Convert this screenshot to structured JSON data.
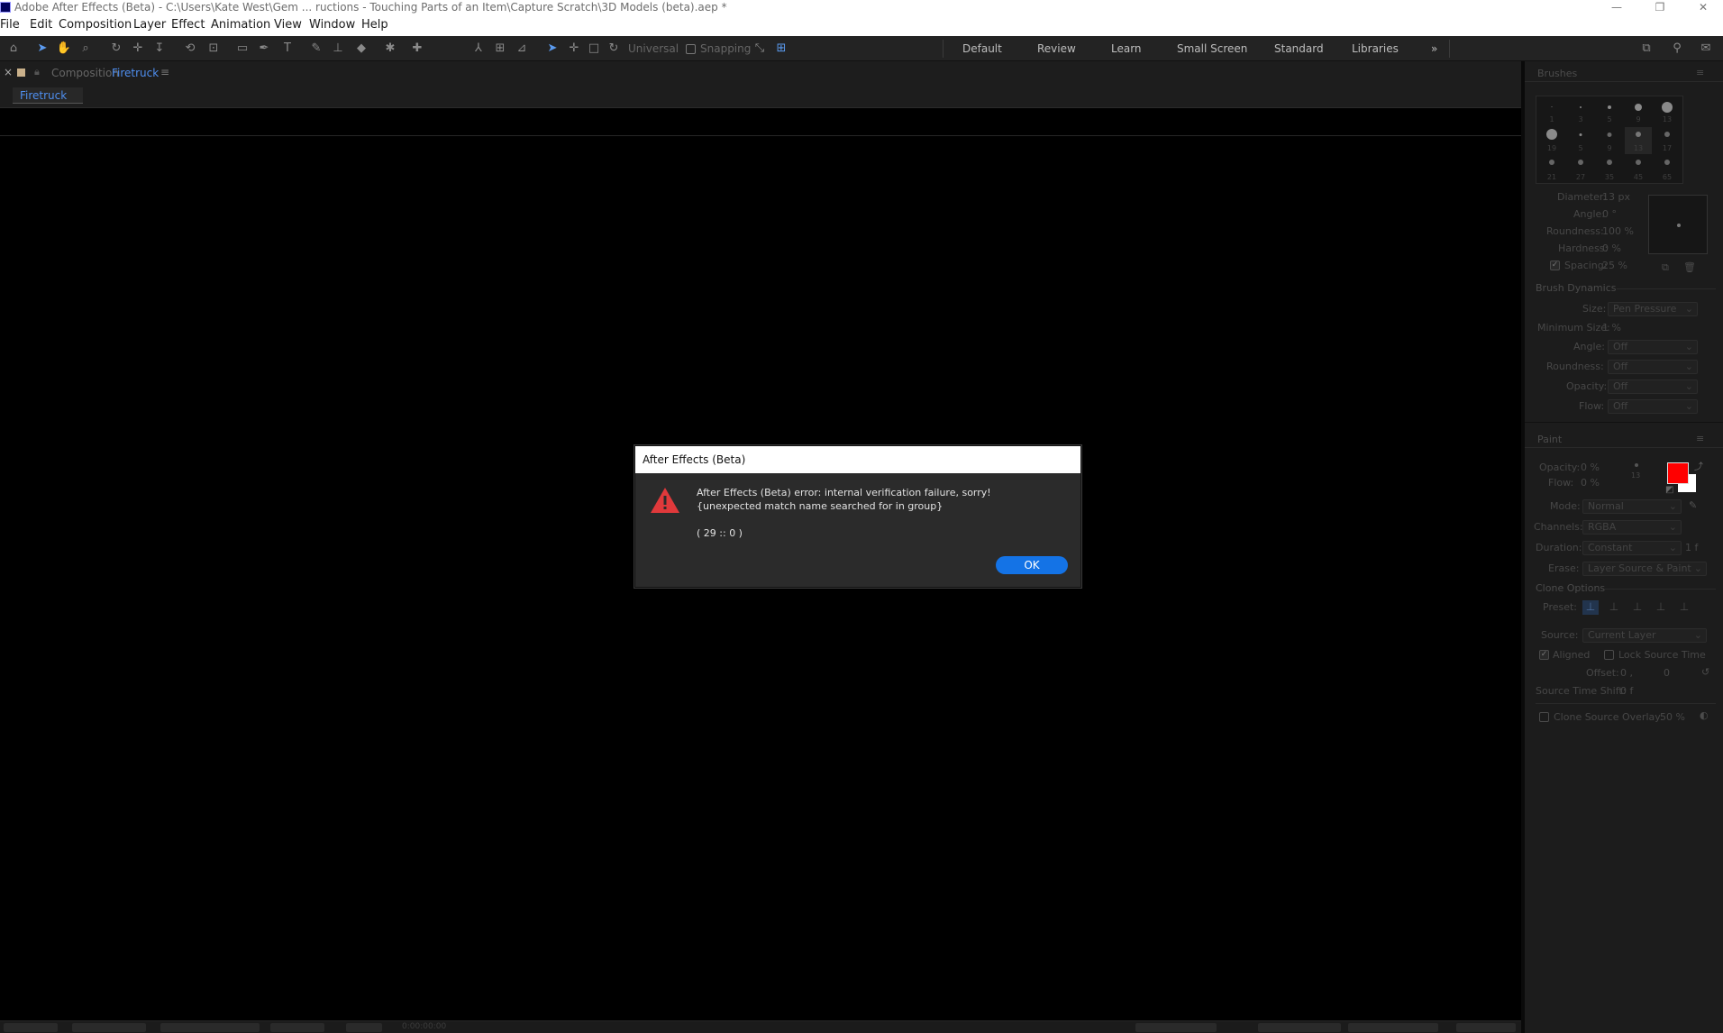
{
  "window": {
    "title": "Adobe After Effects (Beta) - C:\\Users\\Kate West\\Gem ... ructions - Touching Parts of an Item\\Capture Scratch\\3D Models (beta).aep *",
    "minimize": "—",
    "restore": "❐",
    "close": "✕"
  },
  "menu": [
    "File",
    "Edit",
    "Composition",
    "Layer",
    "Effect",
    "Animation",
    "View",
    "Window",
    "Help"
  ],
  "toolbar": {
    "universal_label": "Universal",
    "snapping_label": "Snapping",
    "workspaces": [
      "Default",
      "Review",
      "Learn",
      "Small Screen",
      "Standard",
      "Libraries"
    ],
    "more": "»"
  },
  "composition": {
    "close": "×",
    "panel_label": "Composition",
    "name": "Firetruck",
    "menu": "≡",
    "tab": "Firetruck",
    "status_time": "0:00:00:00"
  },
  "brushes": {
    "heading": "Brushes",
    "menu": "≡",
    "sizes": [
      "1",
      "3",
      "5",
      "9",
      "13",
      "19",
      "5",
      "9",
      "13",
      "17",
      "21",
      "27",
      "35",
      "45",
      "65"
    ],
    "diameter_label": "Diameter:",
    "diameter": "13 px",
    "angle_label": "Angle:",
    "angle": "0 °",
    "roundness_label": "Roundness:",
    "roundness": "100 %",
    "hardness_label": "Hardness:",
    "hardness": "0 %",
    "spacing_label": "Spacing:",
    "spacing": "25 %",
    "dynamics_heading": "Brush Dynamics",
    "size_label": "Size:",
    "size": "Pen Pressure",
    "min_size_label": "Minimum Size:",
    "min_size": "1 %",
    "dyn_angle_label": "Angle:",
    "dyn_angle": "Off",
    "dyn_roundness_label": "Roundness:",
    "dyn_roundness": "Off",
    "opacity_label": "Opacity:",
    "opacity": "Off",
    "flow_label": "Flow:",
    "flow": "Off"
  },
  "paint": {
    "heading": "Paint",
    "menu": "≡",
    "opacity_label": "Opacity:",
    "opacity": "0 %",
    "flow_label": "Flow:",
    "flow": "0 %",
    "brush_size": "13",
    "mode_label": "Mode:",
    "mode": "Normal",
    "channels_label": "Channels:",
    "channels": "RGBA",
    "duration_label": "Duration:",
    "duration": "Constant",
    "duration_val": "1 f",
    "erase_label": "Erase:",
    "erase": "Layer Source & Paint",
    "clone_heading": "Clone Options",
    "preset_label": "Preset:",
    "source_label": "Source:",
    "source": "Current Layer",
    "aligned_label": "Aligned",
    "lock_source_label": "Lock Source Time",
    "offset_label": "Offset:",
    "offset_x": "0 ,",
    "offset_y": "0",
    "source_time_label": "Source Time Shift:",
    "source_time": "0 f",
    "overlay_label": "Clone Source Overlay:",
    "overlay": "50 %",
    "fg_color": "#ff0000",
    "bg_color": "#ffffff"
  },
  "dialog": {
    "title": "After Effects (Beta)",
    "message": "After Effects (Beta) error: internal verification failure, sorry! {unexpected match name searched for in group}",
    "code": "( 29 :: 0 )",
    "ok_label": "OK"
  }
}
